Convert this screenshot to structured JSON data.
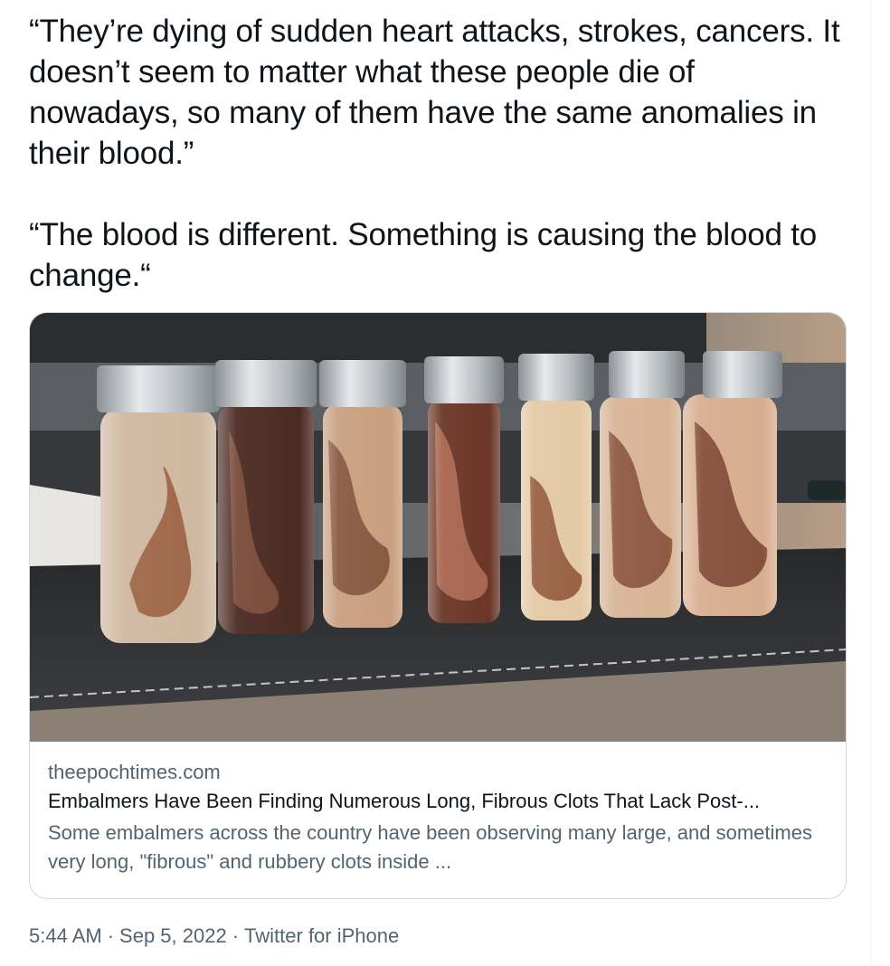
{
  "tweet": {
    "text": "“They’re dying of sudden heart attacks, strokes, cancers. It doesn’t seem to matter what these people die of nowadays, so many of them have the same anomalies in their blood.”\n\n“The blood is different. Something is causing the blood to change.“"
  },
  "card": {
    "domain": "theepochtimes.com",
    "title": "Embalmers Have Been Finding Numerous Long, Fibrous Clots That Lack Post-...",
    "description": "Some embalmers across the country have been observing many large, and sometimes very long, \"fibrous\" and rubbery clots inside ...",
    "image_description": "Seven glass vials with silver caps containing long fibrous clots in liquid, on a black leather desk mat"
  },
  "meta": {
    "time": "5:44 AM",
    "date": "Sep 5, 2022",
    "source": "Twitter for iPhone",
    "separator": "·"
  },
  "colors": {
    "text": "#0f1419",
    "secondary": "#536471",
    "border": "#cfd9de"
  }
}
